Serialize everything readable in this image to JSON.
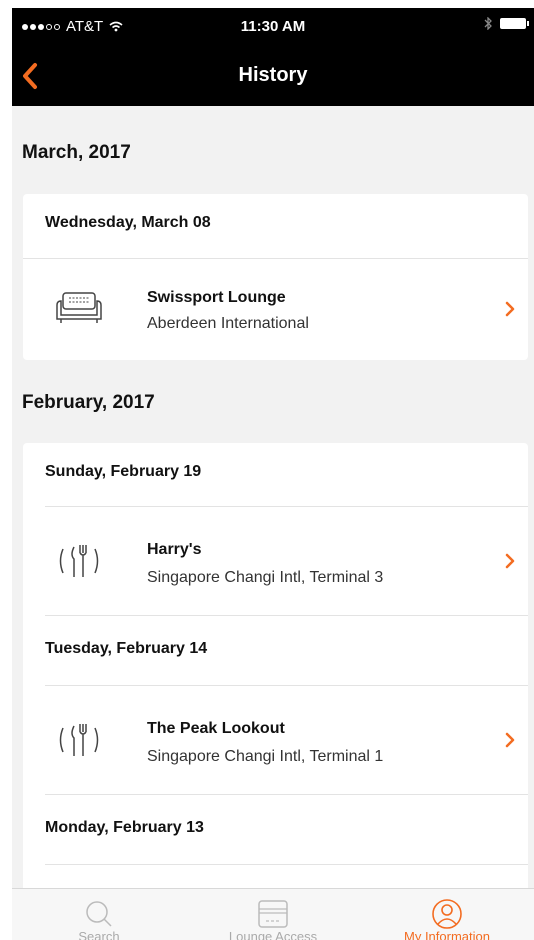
{
  "status_bar": {
    "carrier": "AT&T",
    "time": "11:30 AM"
  },
  "nav": {
    "title": "History"
  },
  "colors": {
    "accent": "#f36c21",
    "nav_bg": "#000000",
    "page_bg": "#f2f2f2"
  },
  "sections": [
    {
      "month": "March, 2017",
      "days": [
        {
          "date": "Wednesday, March 08",
          "entries": [
            {
              "icon": "sofa-icon",
              "name": "Swissport  Lounge",
              "location": "Aberdeen International"
            }
          ]
        }
      ]
    },
    {
      "month": "February, 2017",
      "days": [
        {
          "date": "Sunday, February 19",
          "entries": [
            {
              "icon": "fork-knife-icon",
              "name": "Harry's",
              "location": "Singapore Changi Intl, Terminal 3"
            }
          ]
        },
        {
          "date": "Tuesday, February 14",
          "entries": [
            {
              "icon": "fork-knife-icon",
              "name": "The Peak Lookout",
              "location": "Singapore Changi Intl, Terminal 1"
            }
          ]
        },
        {
          "date": "Monday, February 13",
          "entries": []
        }
      ]
    }
  ],
  "tabs": [
    {
      "label": "Search",
      "icon": "search-icon",
      "active": false
    },
    {
      "label": "Lounge Access",
      "icon": "card-icon",
      "active": false
    },
    {
      "label": "My Information",
      "icon": "user-circle-icon",
      "active": true
    }
  ]
}
